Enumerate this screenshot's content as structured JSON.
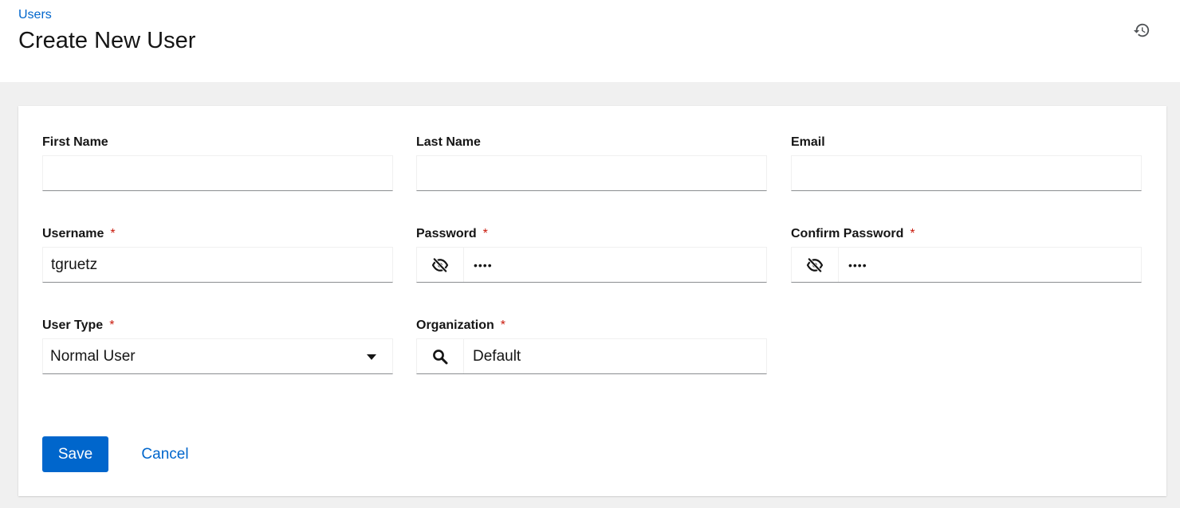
{
  "breadcrumb": {
    "parent": "Users"
  },
  "page": {
    "title": "Create New User"
  },
  "header": {
    "history_icon": "history-icon"
  },
  "form": {
    "first_name": {
      "label": "First Name",
      "value": ""
    },
    "last_name": {
      "label": "Last Name",
      "value": ""
    },
    "email": {
      "label": "Email",
      "value": ""
    },
    "username": {
      "label": "Username",
      "value": "tgruetz",
      "required_mark": "*"
    },
    "password": {
      "label": "Password",
      "value": "••••",
      "required_mark": "*",
      "toggle_icon": "eye-slash-icon"
    },
    "confirm_password": {
      "label": "Confirm Password",
      "value": "••••",
      "required_mark": "*",
      "toggle_icon": "eye-slash-icon"
    },
    "user_type": {
      "label": "User Type",
      "value": "Normal User",
      "required_mark": "*",
      "icon": "caret-down-icon"
    },
    "organization": {
      "label": "Organization",
      "value": "Default",
      "required_mark": "*",
      "icon": "search-icon"
    }
  },
  "actions": {
    "save": "Save",
    "cancel": "Cancel"
  },
  "colors": {
    "primary": "#0066cc",
    "required": "#c9190b",
    "page_bg": "#f0f0f0",
    "text": "#151515"
  }
}
